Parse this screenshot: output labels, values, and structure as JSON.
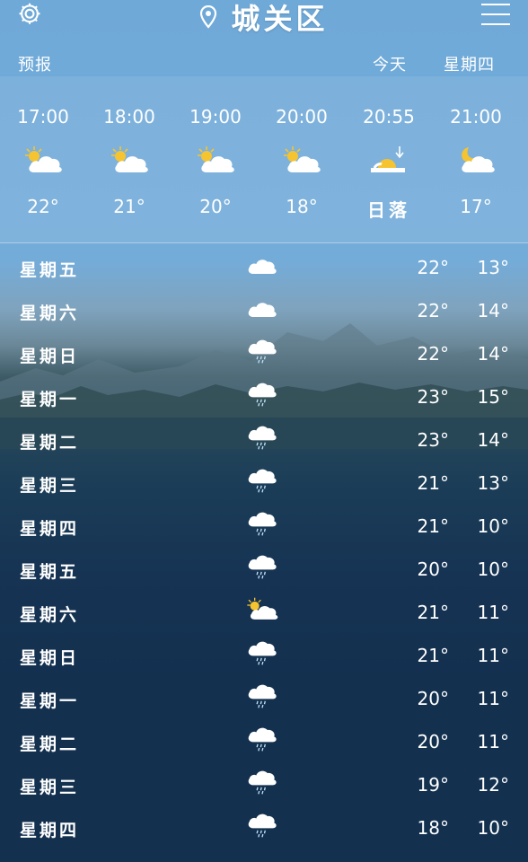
{
  "header": {
    "city": "城关区"
  },
  "subheader": {
    "left": "预报",
    "today": "今天",
    "weekday": "星期四"
  },
  "hourly": [
    {
      "time": "17:00",
      "icon": "partly-cloudy-icon",
      "temp": "22°"
    },
    {
      "time": "18:00",
      "icon": "partly-cloudy-icon",
      "temp": "21°"
    },
    {
      "time": "19:00",
      "icon": "partly-cloudy-icon",
      "temp": "20°"
    },
    {
      "time": "20:00",
      "icon": "partly-cloudy-icon",
      "temp": "18°"
    },
    {
      "time": "20:55",
      "icon": "sunset-icon",
      "temp": "日落"
    },
    {
      "time": "21:00",
      "icon": "moon-cloud-icon",
      "temp": "17°"
    }
  ],
  "daily": [
    {
      "day": "星期五",
      "icon": "cloud-icon",
      "hi": "22°",
      "lo": "13°"
    },
    {
      "day": "星期六",
      "icon": "cloud-icon",
      "hi": "22°",
      "lo": "14°"
    },
    {
      "day": "星期日",
      "icon": "rain-icon",
      "hi": "22°",
      "lo": "14°"
    },
    {
      "day": "星期一",
      "icon": "rain-icon",
      "hi": "23°",
      "lo": "15°"
    },
    {
      "day": "星期二",
      "icon": "rain-icon",
      "hi": "23°",
      "lo": "14°"
    },
    {
      "day": "星期三",
      "icon": "rain-icon",
      "hi": "21°",
      "lo": "13°"
    },
    {
      "day": "星期四",
      "icon": "rain-icon",
      "hi": "21°",
      "lo": "10°"
    },
    {
      "day": "星期五",
      "icon": "rain-icon",
      "hi": "20°",
      "lo": "10°"
    },
    {
      "day": "星期六",
      "icon": "partly-cloudy-icon",
      "hi": "21°",
      "lo": "11°"
    },
    {
      "day": "星期日",
      "icon": "rain-icon",
      "hi": "21°",
      "lo": "11°"
    },
    {
      "day": "星期一",
      "icon": "rain-icon",
      "hi": "20°",
      "lo": "11°"
    },
    {
      "day": "星期二",
      "icon": "rain-icon",
      "hi": "20°",
      "lo": "11°"
    },
    {
      "day": "星期三",
      "icon": "rain-icon",
      "hi": "19°",
      "lo": "12°"
    },
    {
      "day": "星期四",
      "icon": "rain-icon",
      "hi": "18°",
      "lo": "10°"
    }
  ],
  "colors": {
    "sky_top": "#6fa9d8",
    "night_bottom": "#13304f",
    "sun": "#f5c430",
    "cloud": "#ffffff"
  }
}
